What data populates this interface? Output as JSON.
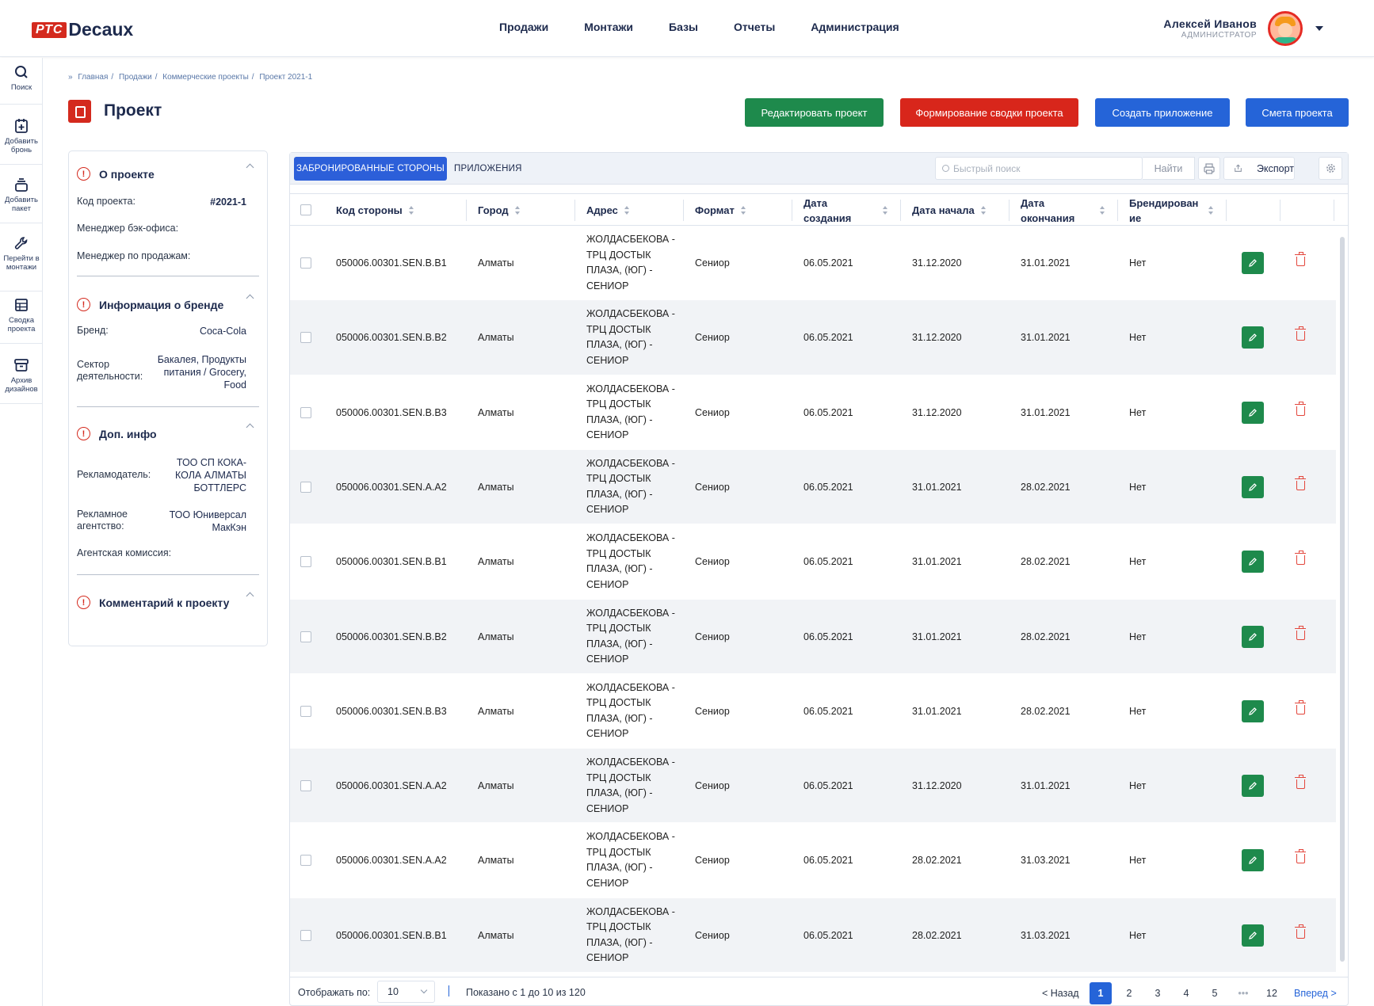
{
  "brand": {
    "logo_mark": "РТС",
    "logo_text": "Decaux"
  },
  "nav": [
    "Продажи",
    "Монтажи",
    "Базы",
    "Отчеты",
    "Администрация"
  ],
  "user": {
    "name": "Алексей Иванов",
    "role": "АДМИНИСТРАТОР"
  },
  "rail": [
    {
      "icon": "search-icon",
      "label": "Поиск"
    },
    {
      "icon": "calendar-plus-icon",
      "label": "Добавить бронь"
    },
    {
      "icon": "layers-icon",
      "label": "Добавить пакет"
    },
    {
      "icon": "wrench-icon",
      "label": "Перейти в монтажи"
    },
    {
      "icon": "table-icon",
      "label": "Сводка проекта"
    },
    {
      "icon": "archive-icon",
      "label": "Архив дизайнов"
    }
  ],
  "breadcrumb": [
    "Главная",
    "Продажи",
    "Коммерческие проекты",
    "Проект 2021-1"
  ],
  "page": {
    "title": "Проект"
  },
  "actions": {
    "edit": "Редактировать проект",
    "summary": "Формирование сводки проекта",
    "create_app": "Создать приложение",
    "estimate": "Смета проекта"
  },
  "about": {
    "title": "О проекте",
    "code_label": "Код проекта:",
    "code_value": "#2021-1",
    "backoffice_label": "Менеджер бэк-офиса:",
    "sales_label": "Менеджер по продажам:"
  },
  "brand_info": {
    "title": "Информация о бренде",
    "brand_label": "Бренд:",
    "brand_value": "Coca-Cola",
    "sector_label": "Сектор деятельности:",
    "sector_value": "Бакалея, Продукты питания / Grocery, Food"
  },
  "extra": {
    "title": "Доп. инфо",
    "advertiser_label": "Рекламодатель:",
    "advertiser_value": "ТОО СП КОКА-КОЛА АЛМАТЫ БОТТЛЕРС",
    "agency_label": "Рекламное агентство:",
    "agency_value": "ТОО Юниверсал МакКэн",
    "commission_label": "Агентская комиссия:"
  },
  "comment": {
    "title": "Комментарий к проекту"
  },
  "tabs": {
    "booked": "ЗАБРОНИРОВАННЫЕ СТОРОНЫ",
    "apps": "ПРИЛОЖЕНИЯ"
  },
  "search": {
    "placeholder": "Быстрый поиск",
    "button": "Найти"
  },
  "export_label": "Экспорт",
  "columns": [
    "Код стороны",
    "Город",
    "Адрес",
    "Формат",
    "Дата создания",
    "Дата начала",
    "Дата окончания",
    "Брендирование"
  ],
  "rows": [
    {
      "code": "050006.00301.SEN.B.B1",
      "city": "Алматы",
      "address": "ЖОЛДАСБЕКОВА - ТРЦ ДОСТЫК ПЛАЗА, (ЮГ) - СЕНИОР",
      "format": "Сениор",
      "created": "06.05.2021",
      "start": "31.12.2020",
      "end": "31.01.2021",
      "branding": "Нет"
    },
    {
      "code": "050006.00301.SEN.B.B2",
      "city": "Алматы",
      "address": "ЖОЛДАСБЕКОВА - ТРЦ ДОСТЫК ПЛАЗА, (ЮГ) - СЕНИОР",
      "format": "Сениор",
      "created": "06.05.2021",
      "start": "31.12.2020",
      "end": "31.01.2021",
      "branding": "Нет"
    },
    {
      "code": "050006.00301.SEN.B.B3",
      "city": "Алматы",
      "address": "ЖОЛДАСБЕКОВА - ТРЦ ДОСТЫК ПЛАЗА, (ЮГ) - СЕНИОР",
      "format": "Сениор",
      "created": "06.05.2021",
      "start": "31.12.2020",
      "end": "31.01.2021",
      "branding": "Нет"
    },
    {
      "code": "050006.00301.SEN.A.A2",
      "city": "Алматы",
      "address": "ЖОЛДАСБЕКОВА - ТРЦ ДОСТЫК ПЛАЗА, (ЮГ) - СЕНИОР",
      "format": "Сениор",
      "created": "06.05.2021",
      "start": "31.01.2021",
      "end": "28.02.2021",
      "branding": "Нет"
    },
    {
      "code": "050006.00301.SEN.B.B1",
      "city": "Алматы",
      "address": "ЖОЛДАСБЕКОВА - ТРЦ ДОСТЫК ПЛАЗА, (ЮГ) - СЕНИОР",
      "format": "Сениор",
      "created": "06.05.2021",
      "start": "31.01.2021",
      "end": "28.02.2021",
      "branding": "Нет"
    },
    {
      "code": "050006.00301.SEN.B.B2",
      "city": "Алматы",
      "address": "ЖОЛДАСБЕКОВА - ТРЦ ДОСТЫК ПЛАЗА, (ЮГ) - СЕНИОР",
      "format": "Сениор",
      "created": "06.05.2021",
      "start": "31.01.2021",
      "end": "28.02.2021",
      "branding": "Нет"
    },
    {
      "code": "050006.00301.SEN.B.B3",
      "city": "Алматы",
      "address": "ЖОЛДАСБЕКОВА - ТРЦ ДОСТЫК ПЛАЗА, (ЮГ) - СЕНИОР",
      "format": "Сениор",
      "created": "06.05.2021",
      "start": "31.01.2021",
      "end": "28.02.2021",
      "branding": "Нет"
    },
    {
      "code": "050006.00301.SEN.A.A2",
      "city": "Алматы",
      "address": "ЖОЛДАСБЕКОВА - ТРЦ ДОСТЫК ПЛАЗА, (ЮГ) - СЕНИОР",
      "format": "Сениор",
      "created": "06.05.2021",
      "start": "31.12.2020",
      "end": "31.01.2021",
      "branding": "Нет"
    },
    {
      "code": "050006.00301.SEN.A.A2",
      "city": "Алматы",
      "address": "ЖОЛДАСБЕКОВА - ТРЦ ДОСТЫК ПЛАЗА, (ЮГ) - СЕНИОР",
      "format": "Сениор",
      "created": "06.05.2021",
      "start": "28.02.2021",
      "end": "31.03.2021",
      "branding": "Нет"
    },
    {
      "code": "050006.00301.SEN.B.B1",
      "city": "Алматы",
      "address": "ЖОЛДАСБЕКОВА - ТРЦ ДОСТЫК ПЛАЗА, (ЮГ) - СЕНИОР",
      "format": "Сениор",
      "created": "06.05.2021",
      "start": "28.02.2021",
      "end": "31.03.2021",
      "branding": "Нет"
    }
  ],
  "pager": {
    "per_page_label": "Отображать по:",
    "per_page_value": "10",
    "info": "Показано с 1 до 10 из 120",
    "prev": "< Назад",
    "pages": [
      "1",
      "2",
      "3",
      "4",
      "5",
      "•••",
      "12"
    ],
    "current": "1",
    "next": "Вперед >"
  },
  "colors": {
    "accent_red": "#d42a1e",
    "primary_blue": "#2564d8",
    "success_green": "#1e8a4c",
    "nav_dark": "#1d2a4d"
  }
}
